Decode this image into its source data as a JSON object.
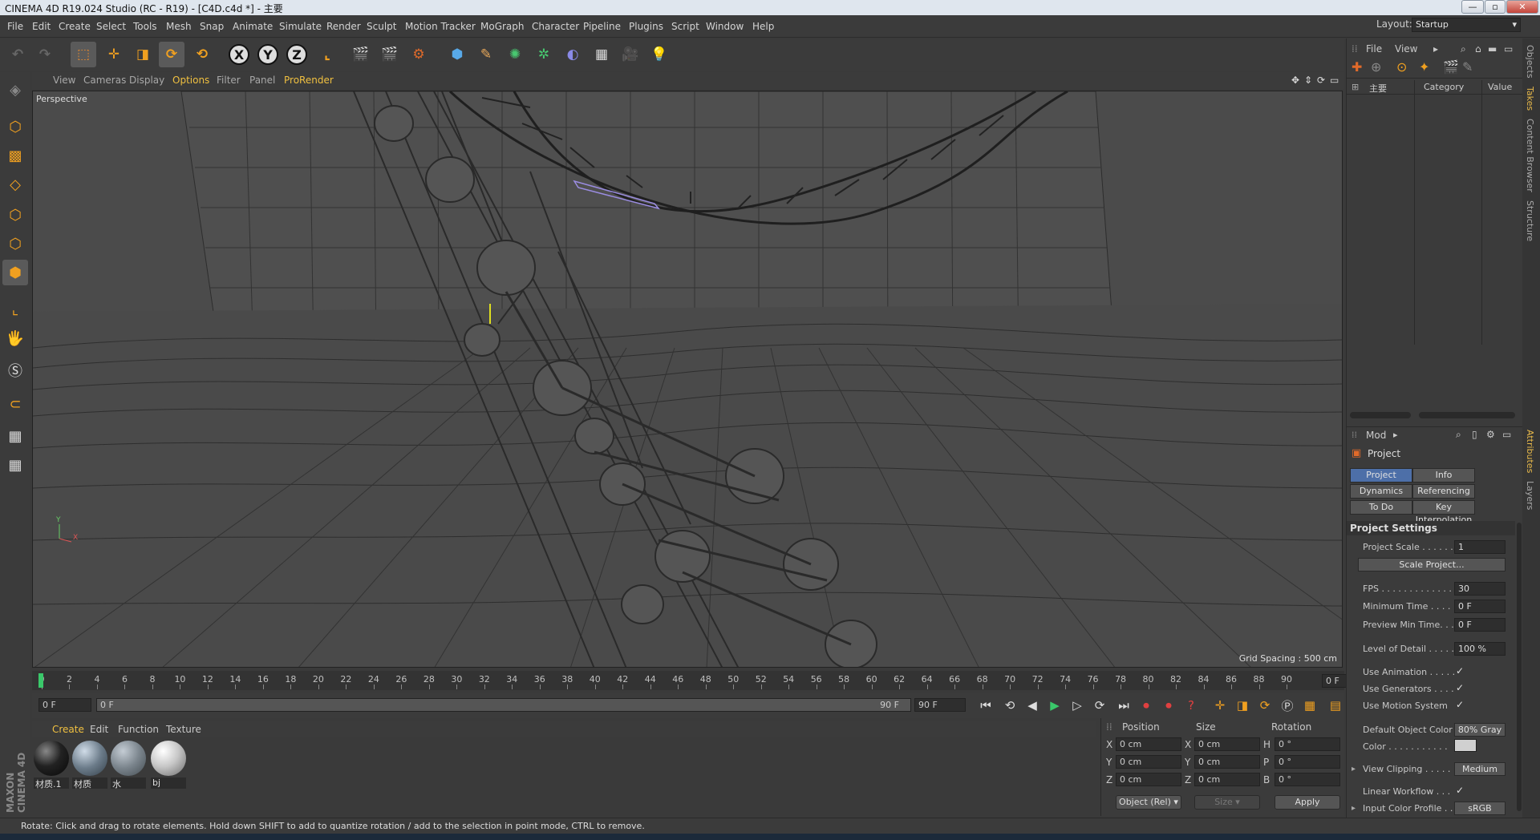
{
  "window": {
    "title": "CINEMA 4D R19.024 Studio (RC - R19) - [C4D.c4d *] - 主要",
    "min": "—",
    "max": "▫",
    "close": "✕"
  },
  "menu": [
    "File",
    "Edit",
    "Create",
    "Select",
    "Tools",
    "Mesh",
    "Snap",
    "Animate",
    "Simulate",
    "Render",
    "Sculpt",
    "Motion Tracker",
    "MoGraph",
    "Character",
    "Pipeline",
    "Plugins",
    "Script",
    "Window",
    "Help"
  ],
  "layout": {
    "label": "Layout:",
    "value": "Startup"
  },
  "viewport": {
    "menu": [
      "View",
      "Cameras",
      "Display",
      "Options",
      "Filter",
      "Panel",
      "ProRender"
    ],
    "camera_label": "Perspective",
    "grid_spacing": "Grid Spacing : 500 cm",
    "axis_y": "Y",
    "axis_x": "X"
  },
  "timeline": {
    "ticks": [
      "0",
      "2",
      "4",
      "6",
      "8",
      "10",
      "12",
      "14",
      "16",
      "18",
      "20",
      "22",
      "24",
      "26",
      "28",
      "30",
      "32",
      "34",
      "36",
      "38",
      "40",
      "42",
      "44",
      "46",
      "48",
      "50",
      "52",
      "54",
      "56",
      "58",
      "60",
      "62",
      "64",
      "66",
      "68",
      "70",
      "72",
      "74",
      "76",
      "78",
      "80",
      "82",
      "84",
      "86",
      "88",
      "90"
    ],
    "current_frame": "0 F",
    "start": "0 F",
    "slider_left": "0 F",
    "slider_right": "90 F",
    "end": "90 F"
  },
  "materials": {
    "menu": [
      "Create",
      "Edit",
      "Function",
      "Texture"
    ],
    "items": [
      {
        "name": "材质.1"
      },
      {
        "name": "材质"
      },
      {
        "name": "水"
      },
      {
        "name": "bj"
      }
    ]
  },
  "coordinates": {
    "headers": [
      "Position",
      "Size",
      "Rotation"
    ],
    "rows": [
      {
        "a": "X",
        "pos": "0 cm",
        "b": "X",
        "size": "0 cm",
        "c": "H",
        "rot": "0 °"
      },
      {
        "a": "Y",
        "pos": "0 cm",
        "b": "Y",
        "size": "0 cm",
        "c": "P",
        "rot": "0 °"
      },
      {
        "a": "Z",
        "pos": "0 cm",
        "b": "Z",
        "size": "0 cm",
        "c": "B",
        "rot": "0 °"
      }
    ],
    "mode": "Object (Rel)",
    "size_mode": "Size",
    "apply": "Apply"
  },
  "objects_panel": {
    "menu": [
      "File",
      "View"
    ],
    "col_main": "主要",
    "col_category": "Category",
    "col_value": "Value"
  },
  "attributes": {
    "mode": "Mod",
    "object": "Project",
    "tabs": [
      "Project Settings",
      "Info",
      "Dynamics",
      "Referencing",
      "To Do",
      "Key Interpolation"
    ],
    "section": "Project Settings",
    "rows": [
      {
        "label": "Project Scale . . . . . .",
        "value": "1"
      },
      {
        "label": "FPS . . . . . . . . . . . . .",
        "value": "30"
      },
      {
        "label": "Minimum Time . . . .",
        "value": "0 F"
      },
      {
        "label": "Preview Min Time. . .",
        "value": "0 F"
      },
      {
        "label": "Level of Detail . . . . .",
        "value": "100 %"
      },
      {
        "label": "Use Animation . . . . .",
        "value": "✓"
      },
      {
        "label": "Use Generators . . . .",
        "value": "✓"
      },
      {
        "label": "Use Motion System",
        "value": "✓"
      },
      {
        "label": "Default Object Color",
        "value": "80% Gray"
      },
      {
        "label": "Color . . . . . . . . . . .",
        "value": ""
      },
      {
        "label": "View Clipping . . . . .",
        "value": "Medium"
      },
      {
        "label": "Linear Workflow . . .",
        "value": "✓"
      },
      {
        "label": "Input Color Profile . .",
        "value": "sRGB"
      }
    ],
    "scale_button": "Scale Project..."
  },
  "side_tabs": [
    "Objects",
    "Takes",
    "Content Browser",
    "Structure",
    "Attributes",
    "Layers"
  ],
  "status": "Rotate: Click and drag to rotate elements. Hold down SHIFT to add to quantize rotation / add to the selection in point mode, CTRL to remove.",
  "colors": {
    "accent": "#4d6fa8",
    "selected_tab": "#e8b94a"
  }
}
